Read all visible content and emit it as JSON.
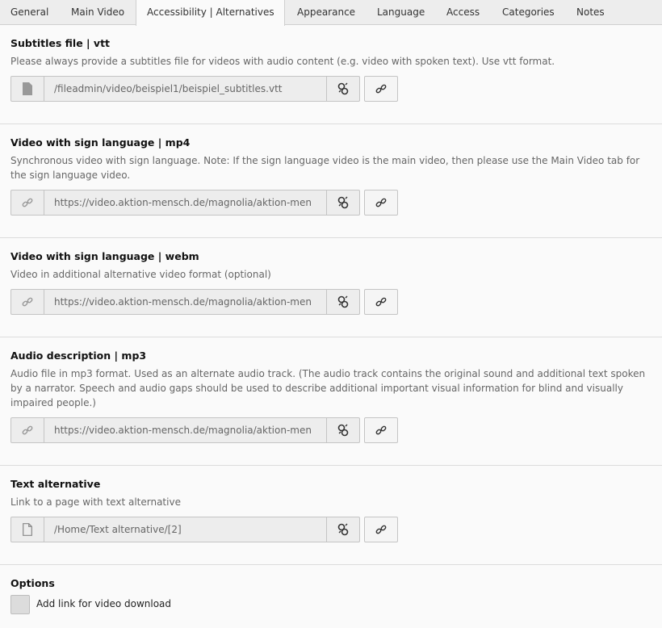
{
  "tabs": [
    {
      "label": "General"
    },
    {
      "label": "Main Video"
    },
    {
      "label": "Accessibility | Alternatives",
      "active": true
    },
    {
      "label": "Appearance"
    },
    {
      "label": "Language"
    },
    {
      "label": "Access"
    },
    {
      "label": "Categories"
    },
    {
      "label": "Notes"
    }
  ],
  "sections": [
    {
      "title": "Subtitles file | vtt",
      "description": "Please always provide a subtitles file for videos with audio content (e.g. video with spoken text). Use vtt format.",
      "field_icon": "file-icon",
      "value": "/fileadmin/video/beispiel1/beispiel_subtitles.vtt"
    },
    {
      "title": "Video with sign language | mp4",
      "description_lines": [
        "Synchronous video with sign language. Note: If the sign language video is the main video, then please use the Main Video tab for",
        "the sign language video."
      ],
      "field_icon": "link-icon",
      "value": "https://video.aktion-mensch.de/magnolia/aktion-men"
    },
    {
      "title": "Video with sign language | webm",
      "description": "Video in additional alternative video format (optional)",
      "field_icon": "link-icon",
      "value": "https://video.aktion-mensch.de/magnolia/aktion-men"
    },
    {
      "title": "Audio description | mp3",
      "description_lines": [
        "Audio file in mp3 format. Used as an alternate audio track. (The audio track contains the original sound and additional text spoken",
        "by a narrator. Speech and audio gaps should be used to describe additional important visual information for blind and visually",
        "impaired people.)"
      ],
      "field_icon": "link-icon",
      "value": "https://video.aktion-mensch.de/magnolia/aktion-men"
    },
    {
      "title": "Text alternative",
      "description": "Link to a page with text alternative",
      "field_icon": "page-icon",
      "value": "/Home/Text alternative/[2]"
    }
  ],
  "options": {
    "title": "Options",
    "checkbox_label": "Add link for video download",
    "checked": false
  },
  "icons": {
    "clear_field": "broken-link-icon",
    "browse": "link-icon"
  },
  "colors": {
    "tabbar": "#ededed",
    "field_bg": "#ededed",
    "border": "#c4c4c4"
  }
}
